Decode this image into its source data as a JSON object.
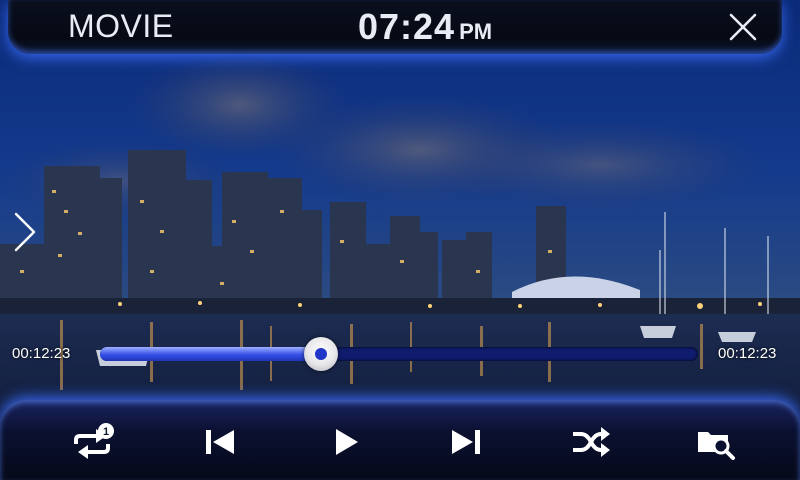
{
  "header": {
    "title": "MOVIE",
    "time": "07:24",
    "ampm": "PM",
    "close_icon": "close-icon"
  },
  "side_nav": {
    "icon": "chevron-right-icon"
  },
  "playback": {
    "elapsed": "00:12:23",
    "total": "00:12:23",
    "progress_fraction": 0.37
  },
  "controls": [
    {
      "name": "repeat-one-button",
      "icon": "repeat-one-icon",
      "badge": "1"
    },
    {
      "name": "previous-button",
      "icon": "skip-previous-icon"
    },
    {
      "name": "play-button",
      "icon": "play-icon"
    },
    {
      "name": "next-button",
      "icon": "skip-next-icon"
    },
    {
      "name": "shuffle-button",
      "icon": "shuffle-icon"
    },
    {
      "name": "browse-folder-button",
      "icon": "folder-search-icon"
    }
  ],
  "colors": {
    "accent": "#3450e8",
    "glow": "#3c6eff",
    "text": "#e8ecf4"
  }
}
